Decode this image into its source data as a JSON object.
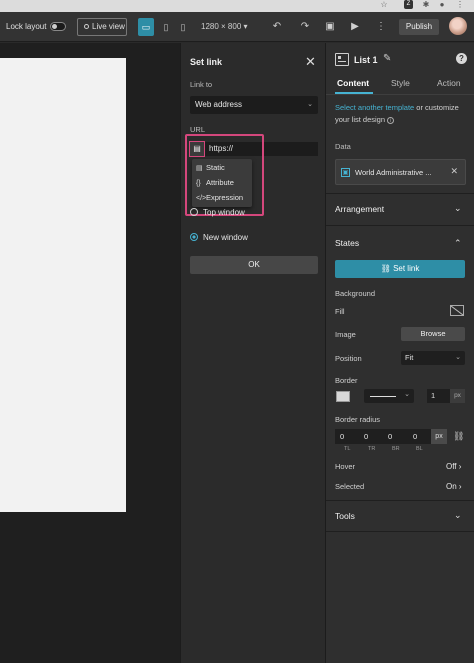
{
  "toolbar": {
    "lock_layout_label": "Lock layout",
    "live_view_label": "Live view",
    "resolution": "1280 × 800",
    "publish_label": "Publish"
  },
  "set_link_panel": {
    "title": "Set link",
    "link_to_label": "Link to",
    "link_to_value": "Web address",
    "url_label": "URL",
    "url_value": "https://",
    "menu_items": [
      {
        "icon": "document-icon",
        "glyph": "▤",
        "label": "Static"
      },
      {
        "icon": "braces-icon",
        "glyph": "{}",
        "label": "Attribute"
      },
      {
        "icon": "code-icon",
        "glyph": "</>",
        "label": "Expression"
      }
    ],
    "top_window_label": "Top window",
    "new_window_label": "New window",
    "ok_label": "OK"
  },
  "settings_panel": {
    "title": "List 1",
    "tabs": [
      "Content",
      "Style",
      "Action"
    ],
    "active_tab": "Content",
    "template_link": "Select another template",
    "template_desc": " or customize your list design",
    "data_label": "Data",
    "data_source": "World Administrative ...",
    "arrangement_label": "Arrangement",
    "states_label": "States",
    "set_link_label": "Set link",
    "background_label": "Background",
    "fill_label": "Fill",
    "image_label": "Image",
    "browse_label": "Browse",
    "position_label": "Position",
    "position_value": "Fit",
    "border_label": "Border",
    "border_width": "1",
    "border_unit": "px",
    "border_radius_label": "Border radius",
    "radius_values": [
      "0",
      "0",
      "0",
      "0"
    ],
    "radius_unit": "px",
    "corner_labels": [
      "TL",
      "TR",
      "BR",
      "BL"
    ],
    "hover_label": "Hover",
    "hover_value": "Off",
    "selected_label": "Selected",
    "selected_value": "On",
    "tools_label": "Tools"
  },
  "colors": {
    "accent": "#46b3d2",
    "highlight": "#d4477c"
  }
}
